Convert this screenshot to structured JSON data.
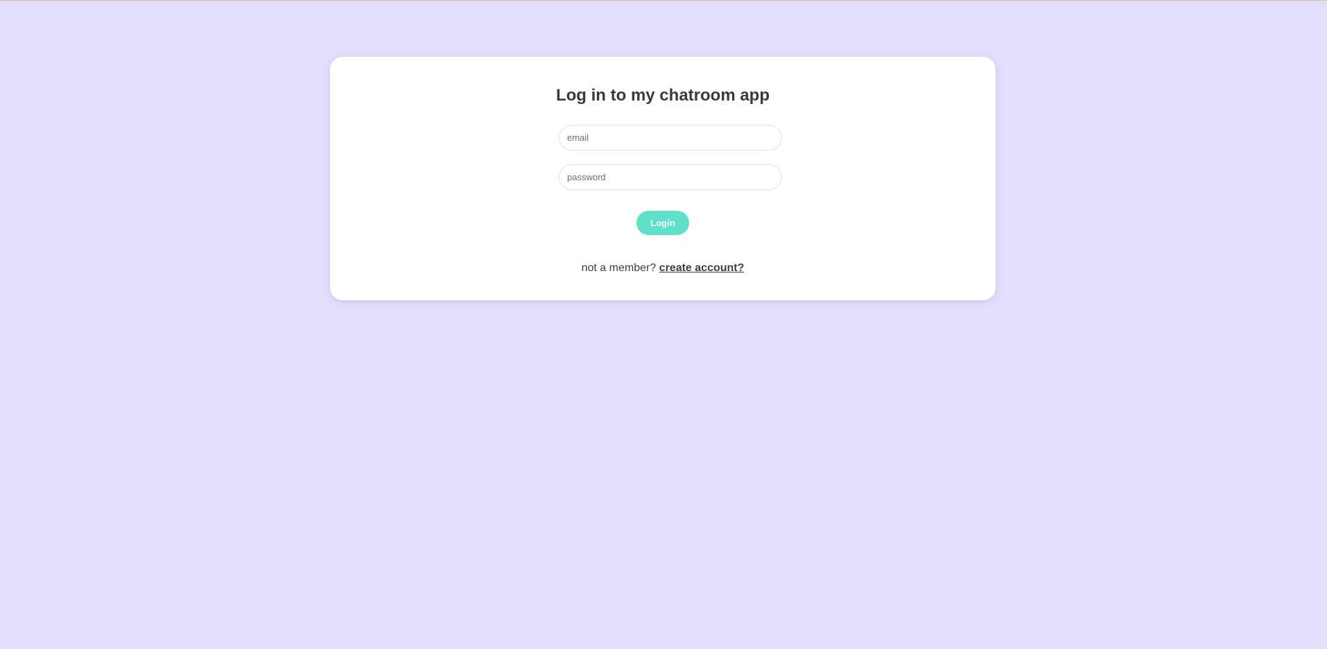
{
  "colors": {
    "background": "#e3e0fd",
    "card": "#ffffff",
    "accent": "#5ee0c9",
    "text": "#3d3d3d"
  },
  "login_form": {
    "title": "Log in to my chatroom app",
    "email": {
      "value": "",
      "placeholder": "email"
    },
    "password": {
      "value": "",
      "placeholder": "password"
    },
    "submit_label": "Login",
    "signup_prompt": "not a member?",
    "signup_link": "create account?"
  }
}
